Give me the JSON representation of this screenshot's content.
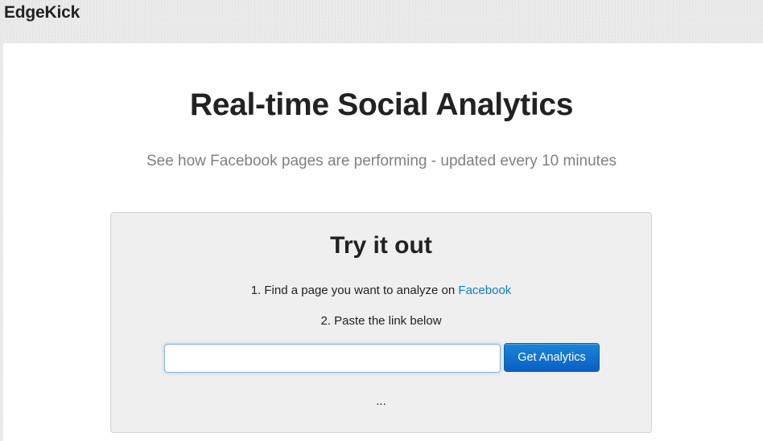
{
  "header": {
    "brand": "EdgeKick"
  },
  "hero": {
    "title": "Real-time Social Analytics",
    "subtitle": "See how Facebook pages are performing - updated every 10 minutes"
  },
  "try_it": {
    "title": "Try it out",
    "step1_prefix": "1. Find a page you want to analyze on ",
    "step1_link": "Facebook",
    "step2": "2. Paste the link below",
    "input_value": "",
    "button_label": "Get Analytics",
    "status": "..."
  },
  "colors": {
    "link": "#0a80c7",
    "button": "#0b5fc2",
    "subtitle": "#808080"
  }
}
